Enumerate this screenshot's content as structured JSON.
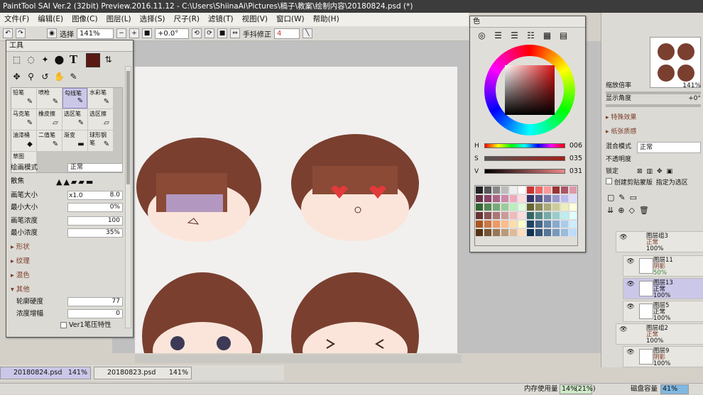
{
  "title": "PaintTool SAI Ver.2 (32bit) Preview.2016.11.12 - C:\\Users\\ShiinaAi\\Pictures\\稿子\\教案\\绘制内容\\20180824.psd (*)",
  "menu": [
    "文件(F)",
    "编辑(E)",
    "图像(C)",
    "图层(L)",
    "选择(S)",
    "尺子(R)",
    "滤镜(T)",
    "视图(V)",
    "窗口(W)",
    "帮助(H)"
  ],
  "toolbar": {
    "select_label": "选择",
    "zoom": "141%",
    "angle": "+0.0°",
    "stabilizer_label": "手抖修正",
    "stabilizer": "4"
  },
  "tool_panel": {
    "title": "工具",
    "brushes": [
      {
        "name": "铅笔"
      },
      {
        "name": "喷枪"
      },
      {
        "name": "勾线笔",
        "selected": true
      },
      {
        "name": "水彩笔"
      },
      {
        "name": "马克笔"
      },
      {
        "name": "橡皮擦"
      },
      {
        "name": "选区笔"
      },
      {
        "name": "选区擦"
      },
      {
        "name": "油漆桶"
      },
      {
        "name": "二值笔"
      },
      {
        "name": "渐变"
      },
      {
        "name": "球形钢笔"
      },
      {
        "name": "草图"
      }
    ],
    "blend_mode_label": "绘画模式",
    "blend_mode": "正常",
    "blur_label": "散焦",
    "brush_size_label": "画笔大小",
    "brush_size_mult": "x1.0",
    "brush_size": "8.0",
    "min_size_label": "最小大小",
    "min_size": "0%",
    "density_label": "画笔浓度",
    "density": "100",
    "min_density_label": "最小浓度",
    "min_density": "35%",
    "sections": [
      "形状",
      "纹理",
      "混色",
      "其他"
    ],
    "edge_label": "轮廓硬度",
    "edge": "77",
    "density_boost_label": "浓度增幅",
    "density_boost": "0",
    "ver1_label": "Ver1笔压特性"
  },
  "color_panel": {
    "title": "色",
    "h": "006",
    "s": "035",
    "v": "031"
  },
  "right_panel": {
    "zoom_label": "缩放倍率",
    "zoom": "141%",
    "angle_label": "显示角度",
    "angle": "+0°",
    "effects": "特殊效果",
    "paper": "纸张质感",
    "blend_label": "混合模式",
    "blend": "正常",
    "opacity_label": "不透明度",
    "lock_label": "锁定",
    "clip_label": "创建剪贴蒙版",
    "sel_source_label": "指定为选区",
    "layers": [
      {
        "name": "图层组3",
        "mode": "正常",
        "opacity": "100%",
        "group": true
      },
      {
        "name": "图层11",
        "mode": "阴影",
        "opacity": "50%"
      },
      {
        "name": "图层13",
        "mode": "正常",
        "opacity": "100%",
        "selected": true
      },
      {
        "name": "图层5",
        "mode": "正常",
        "opacity": "100%"
      },
      {
        "name": "图层组2",
        "mode": "正常",
        "opacity": "100%",
        "group": true
      },
      {
        "name": "图层9",
        "mode": "阴影",
        "opacity": "100%"
      }
    ]
  },
  "tabs": [
    {
      "name": "20180824.psd",
      "zoom": "141%",
      "selected": true
    },
    {
      "name": "20180823.psd",
      "zoom": "141%"
    }
  ],
  "status": {
    "mem_label": "内存使用量",
    "mem": "14%",
    "mem_paren": "(21%)",
    "disk_label": "磁盘容量",
    "disk": "41%"
  }
}
